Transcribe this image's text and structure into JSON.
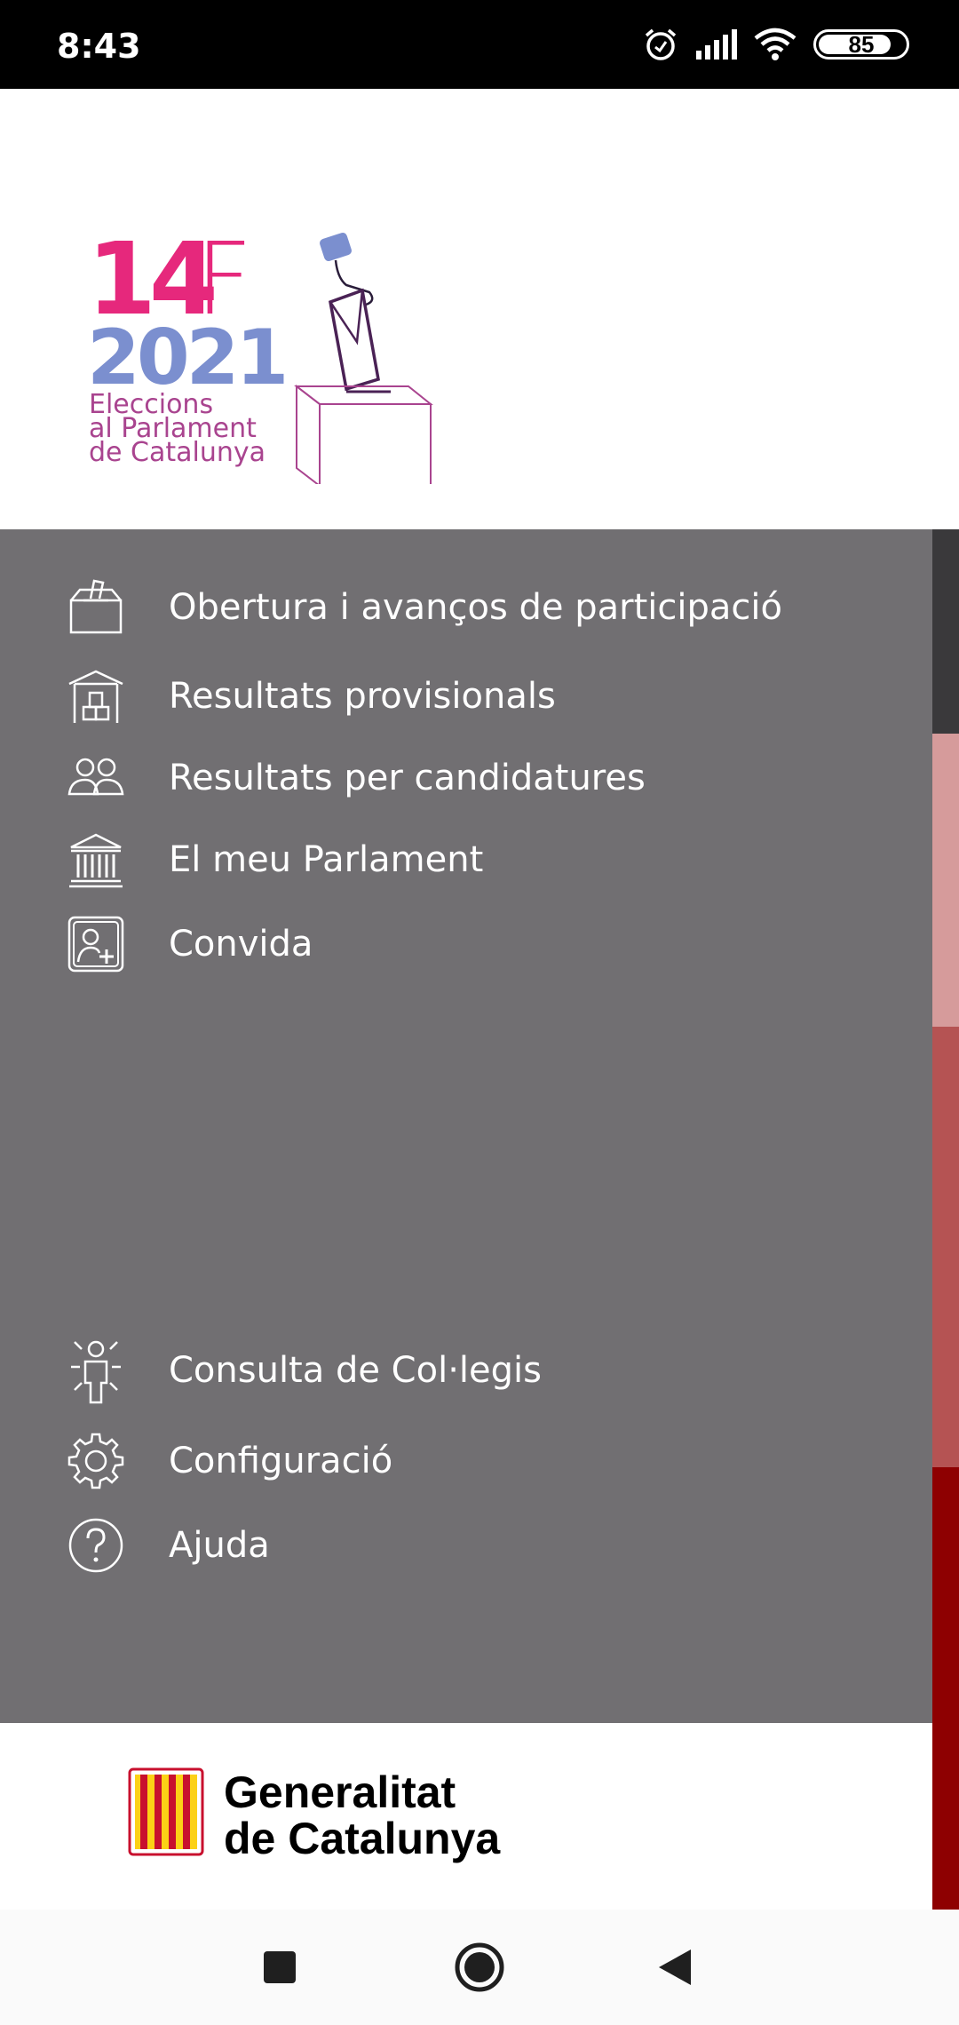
{
  "status_bar": {
    "time": "8:43",
    "battery_level": 85,
    "battery_label": "85",
    "icons": [
      "alarm-icon",
      "signal-icon",
      "wifi-icon",
      "battery-icon"
    ]
  },
  "logo": {
    "line1_number": "14",
    "line1_letter": "F",
    "line2": "2021",
    "line3": "Eleccions",
    "line4": "al Parlament",
    "line5": "de Catalunya"
  },
  "menu": {
    "items": [
      {
        "label": "Obertura i avanços de participació",
        "icon": "ballot-box-icon"
      },
      {
        "label": "Resultats provisionals",
        "icon": "results-building-icon"
      },
      {
        "label": "Resultats per candidatures",
        "icon": "candidates-icon"
      },
      {
        "label": "El meu Parlament",
        "icon": "parliament-icon"
      },
      {
        "label": "Convida",
        "icon": "invite-user-icon"
      }
    ],
    "secondary_items": [
      {
        "label": "Consulta de Col·legis",
        "icon": "polling-station-icon"
      },
      {
        "label": "Configuració",
        "icon": "gear-icon"
      },
      {
        "label": "Ajuda",
        "icon": "help-icon"
      }
    ]
  },
  "footer": {
    "line1": "Generalitat",
    "line2": "de Catalunya"
  },
  "colors": {
    "menu_background": "#716f72",
    "logo_pink": "#e6287c",
    "logo_blue": "#7b8fcf",
    "logo_purple": "#a9448f",
    "strip": [
      "#3a393b",
      "#d69b9b",
      "#b55353",
      "#8e0001"
    ]
  },
  "nav_bar": {
    "buttons": [
      "recents-icon",
      "home-icon",
      "back-icon"
    ]
  }
}
